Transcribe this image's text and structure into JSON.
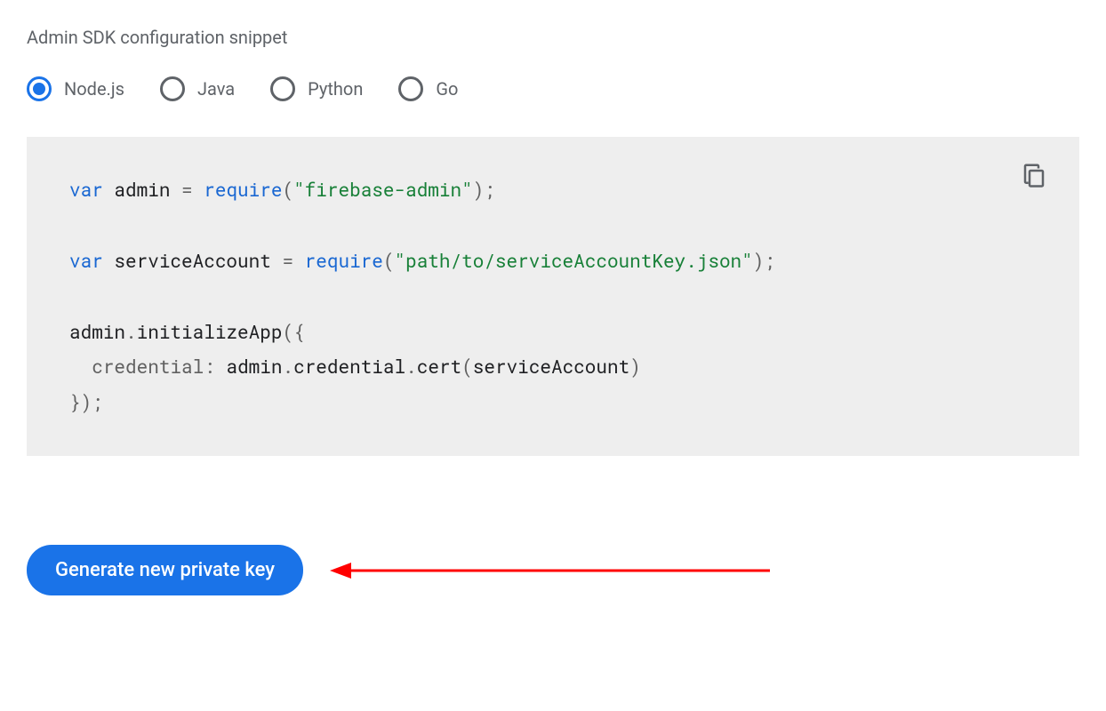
{
  "section": {
    "title": "Admin SDK configuration snippet"
  },
  "languages": {
    "options": [
      {
        "label": "Node.js",
        "selected": true
      },
      {
        "label": "Java",
        "selected": false
      },
      {
        "label": "Python",
        "selected": false
      },
      {
        "label": "Go",
        "selected": false
      }
    ]
  },
  "code": {
    "line1_kw": "var",
    "line1_name": " admin ",
    "line1_eq": "= ",
    "line1_fn": "require",
    "line1_paren_open": "(",
    "line1_str": "\"firebase-admin\"",
    "line1_end": ");",
    "line2_kw": "var",
    "line2_name": " serviceAccount ",
    "line2_eq": "= ",
    "line2_fn": "require",
    "line2_paren_open": "(",
    "line2_str": "\"path/to/serviceAccountKey.json\"",
    "line2_end": ");",
    "line3_a": "admin",
    "line3_dot1": ".",
    "line3_b": "initializeApp",
    "line3_c": "({",
    "line4_indent": "  ",
    "line4_prop": "credential",
    "line4_colon": ": ",
    "line4_a": "admin",
    "line4_dot1": ".",
    "line4_b": "credential",
    "line4_dot2": ".",
    "line4_c": "cert",
    "line4_paren_open": "(",
    "line4_arg": "serviceAccount",
    "line4_paren_close": ")",
    "line5": "});"
  },
  "button": {
    "generate_label": "Generate new private key"
  }
}
